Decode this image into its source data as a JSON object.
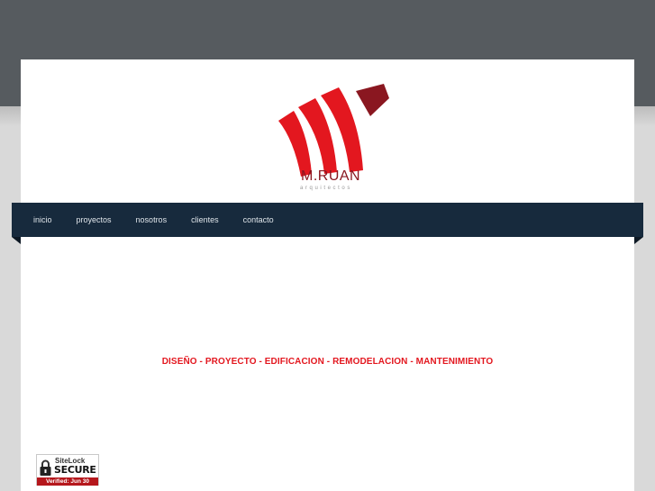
{
  "logo": {
    "name": "M.RUAN",
    "subtitle": "arquitectos"
  },
  "nav": {
    "items": [
      {
        "label": "inicio"
      },
      {
        "label": "proyectos"
      },
      {
        "label": "nosotros"
      },
      {
        "label": "clientes"
      },
      {
        "label": "contacto"
      }
    ]
  },
  "main": {
    "tagline": "DISEÑO - PROYECTO - EDIFICACION - REMODELACION - MANTENIMIENTO"
  },
  "badge": {
    "brand": "SiteLock",
    "status": "SECURE",
    "verified": "Verified: Jun 30"
  },
  "colors": {
    "brand_red": "#e3171f",
    "dark_red": "#8a1720",
    "nav_bg": "#172a3d",
    "header_band": "#565b5f"
  }
}
